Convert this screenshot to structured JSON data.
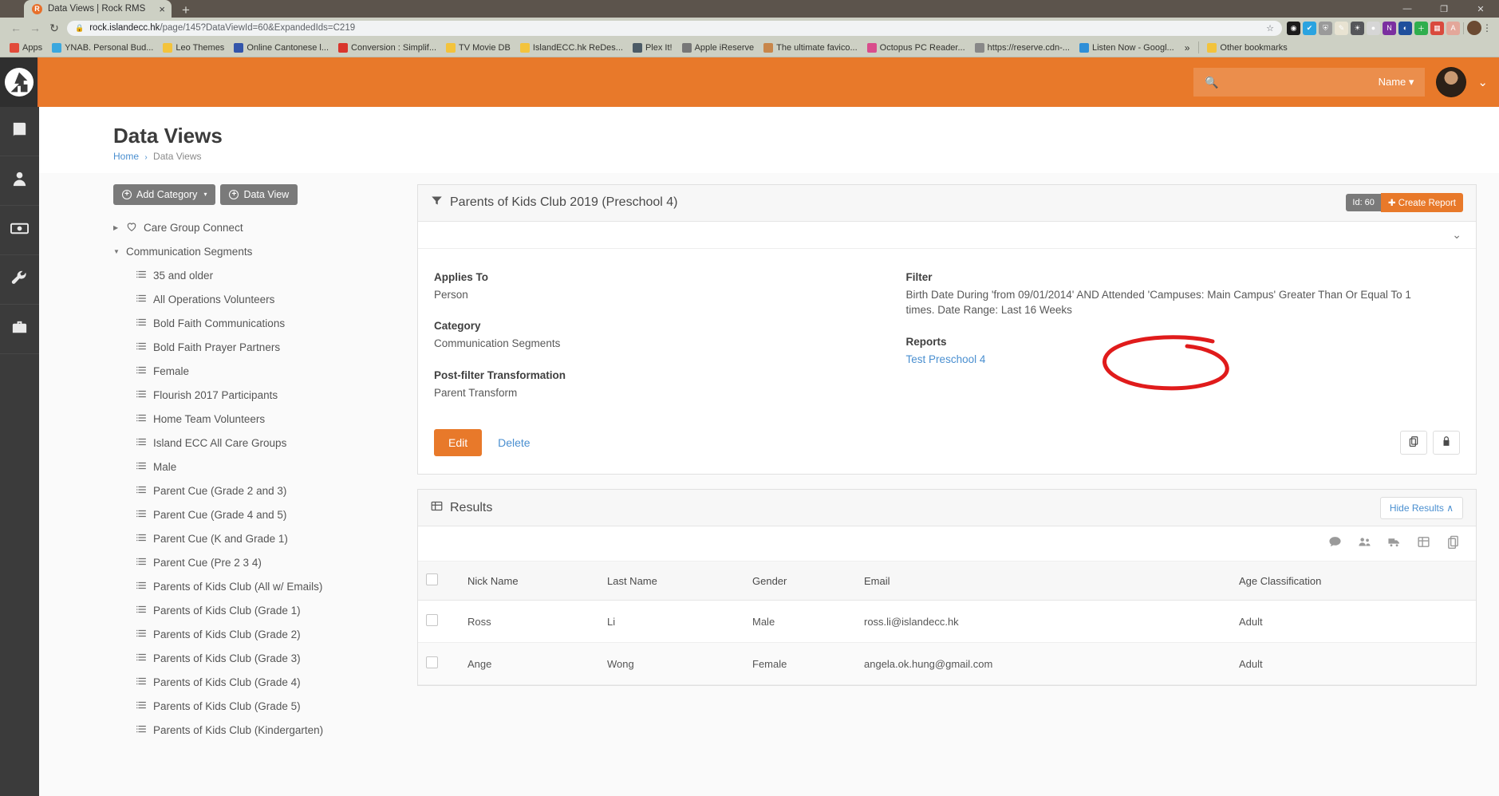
{
  "browser": {
    "tab": {
      "title": "Data Views | Rock RMS",
      "favicon_letter": "R",
      "close": "×"
    },
    "new_tab": "+",
    "window_controls": {
      "minimize": "—",
      "maximize": "❐",
      "close": "✕"
    },
    "nav": {
      "back": "←",
      "forward": "→",
      "reload": "↻"
    },
    "omnibox": {
      "lock": "🔒",
      "url_host": "rock.islandecc.hk",
      "url_path": "/page/145?DataViewId=60&ExpandedIds=C219",
      "star": "☆"
    },
    "extensions": [
      {
        "name": "chrome-extension-circle",
        "glyph": "◉",
        "color": "#1b1b1b"
      },
      {
        "name": "checkmark-extension",
        "glyph": "✔",
        "color": "#2aa3e0"
      },
      {
        "name": "shield-extension",
        "glyph": "⛨",
        "color": "#9a9a9a"
      },
      {
        "name": "paint-extension",
        "glyph": "✎",
        "color": "#e8e3d2"
      },
      {
        "name": "bulb-extension",
        "glyph": "☀",
        "color": "#55565a"
      },
      {
        "name": "balloon-extension",
        "glyph": "●",
        "color": "#d6d6d6"
      },
      {
        "name": "onenote-extension",
        "glyph": "N",
        "color": "#7b2fa0"
      },
      {
        "name": "lastpass-extension",
        "glyph": "◐",
        "color": "#1f4f9c"
      },
      {
        "name": "add-extension",
        "glyph": "＋",
        "color": "#2fae4e"
      },
      {
        "name": "colorpicker-extension",
        "glyph": "▦",
        "color": "#d94a3d"
      },
      {
        "name": "acrobat-extension",
        "glyph": "A",
        "color": "#e3a79a"
      }
    ],
    "menu_kebab": "⋮",
    "bookmarks": [
      {
        "label": "Apps",
        "icon": "apps-icon",
        "color": "#e24b3a"
      },
      {
        "label": "YNAB. Personal Bud...",
        "icon": "globe-icon",
        "color": "#3ba7de"
      },
      {
        "label": "Leo Themes",
        "icon": "folder-icon",
        "color": "#f3c33c"
      },
      {
        "label": "Online Cantonese l...",
        "icon": "site-icon",
        "color": "#3355aa"
      },
      {
        "label": "Conversion : Simplif...",
        "icon": "site-icon",
        "color": "#d9352c"
      },
      {
        "label": "TV Movie DB",
        "icon": "folder-icon",
        "color": "#f3c33c"
      },
      {
        "label": "IslandECC.hk ReDes...",
        "icon": "folder-icon",
        "color": "#f3c33c"
      },
      {
        "label": "Plex It!",
        "icon": "plex-icon",
        "color": "#4c5b66"
      },
      {
        "label": "Apple iReserve",
        "icon": "apple-icon",
        "color": "#777777"
      },
      {
        "label": "The ultimate favico...",
        "icon": "face-icon",
        "color": "#c8864a"
      },
      {
        "label": "Octopus PC Reader...",
        "icon": "octopus-icon",
        "color": "#d94d8c"
      },
      {
        "label": "https://reserve.cdn-...",
        "icon": "apple-icon",
        "color": "#888888"
      },
      {
        "label": "Listen Now - Googl...",
        "icon": "play-icon",
        "color": "#2f8fd8"
      }
    ],
    "bookmark_overflow": "»",
    "other_bookmarks": {
      "label": "Other bookmarks",
      "icon": "folder-icon"
    }
  },
  "rail": {
    "logo_name": "rock-rms-logo",
    "items": [
      {
        "name": "sidebar-item-cms",
        "icon": "book-icon"
      },
      {
        "name": "sidebar-item-people",
        "icon": "person-icon"
      },
      {
        "name": "sidebar-item-finance",
        "icon": "money-icon"
      },
      {
        "name": "sidebar-item-admin-tools",
        "icon": "wrench-icon"
      },
      {
        "name": "sidebar-item-toolbox",
        "icon": "toolbox-icon"
      }
    ]
  },
  "topbar": {
    "search_placeholder": "",
    "search_value": "",
    "search_scope": "Name",
    "scope_caret": "▾",
    "user_caret": "⌄"
  },
  "page": {
    "title": "Data Views",
    "breadcrumb": {
      "home": "Home",
      "separator": "›",
      "current": "Data Views"
    }
  },
  "tree": {
    "buttons": {
      "add_category": "Add Category",
      "add_category_caret": "▾",
      "data_view": "Data View"
    },
    "nodes": [
      {
        "label": "Care Group Connect",
        "level": 0,
        "icon": "heart-icon",
        "arrow": "▶",
        "expanded": false
      },
      {
        "label": "Communication Segments",
        "level": 0,
        "icon": "none",
        "arrow": "▼",
        "expanded": true
      },
      {
        "label": "35 and older",
        "level": 1,
        "icon": "list-icon"
      },
      {
        "label": "All Operations Volunteers",
        "level": 1,
        "icon": "list-icon"
      },
      {
        "label": "Bold Faith Communications",
        "level": 1,
        "icon": "list-icon"
      },
      {
        "label": "Bold Faith Prayer Partners",
        "level": 1,
        "icon": "list-icon"
      },
      {
        "label": "Female",
        "level": 1,
        "icon": "list-icon"
      },
      {
        "label": "Flourish 2017 Participants",
        "level": 1,
        "icon": "list-icon"
      },
      {
        "label": "Home Team Volunteers",
        "level": 1,
        "icon": "list-icon"
      },
      {
        "label": "Island ECC All Care Groups",
        "level": 1,
        "icon": "list-icon"
      },
      {
        "label": "Male",
        "level": 1,
        "icon": "list-icon"
      },
      {
        "label": "Parent Cue (Grade 2 and 3)",
        "level": 1,
        "icon": "list-icon"
      },
      {
        "label": "Parent Cue (Grade 4 and 5)",
        "level": 1,
        "icon": "list-icon"
      },
      {
        "label": "Parent Cue (K and Grade 1)",
        "level": 1,
        "icon": "list-icon"
      },
      {
        "label": "Parent Cue (Pre 2 3 4)",
        "level": 1,
        "icon": "list-icon"
      },
      {
        "label": "Parents of Kids Club (All w/ Emails)",
        "level": 1,
        "icon": "list-icon"
      },
      {
        "label": "Parents of Kids Club (Grade 1)",
        "level": 1,
        "icon": "list-icon"
      },
      {
        "label": "Parents of Kids Club (Grade 2)",
        "level": 1,
        "icon": "list-icon"
      },
      {
        "label": "Parents of Kids Club (Grade 3)",
        "level": 1,
        "icon": "list-icon"
      },
      {
        "label": "Parents of Kids Club (Grade 4)",
        "level": 1,
        "icon": "list-icon"
      },
      {
        "label": "Parents of Kids Club (Grade 5)",
        "level": 1,
        "icon": "list-icon"
      },
      {
        "label": "Parents of Kids Club (Kindergarten)",
        "level": 1,
        "icon": "list-icon"
      }
    ]
  },
  "detail_panel": {
    "title": "Parents of Kids Club 2019 (Preschool 4)",
    "id_badge": "Id: 60",
    "create_report": "Create Report",
    "collapse_caret": "⌄",
    "fields": {
      "applies_to_label": "Applies To",
      "applies_to_value": "Person",
      "category_label": "Category",
      "category_value": "Communication Segments",
      "post_filter_label": "Post-filter Transformation",
      "post_filter_value": "Parent Transform",
      "filter_label": "Filter",
      "filter_value": "Birth Date During 'from 09/01/2014' AND Attended 'Campuses: Main Campus' Greater Than Or Equal To 1 times. Date Range: Last 16 Weeks",
      "reports_label": "Reports",
      "reports_value": "Test Preschool 4"
    },
    "edit": "Edit",
    "delete": "Delete",
    "footer_icons": [
      {
        "name": "copy-icon"
      },
      {
        "name": "lock-icon"
      }
    ]
  },
  "results_panel": {
    "title": "Results",
    "hide_results": "Hide Results",
    "hide_caret": "∧",
    "grid_icons": [
      {
        "name": "communicate-icon"
      },
      {
        "name": "group-icon"
      },
      {
        "name": "merge-truck-icon"
      },
      {
        "name": "excel-export-icon"
      },
      {
        "name": "copy-icon"
      }
    ],
    "columns": [
      "Nick Name",
      "Last Name",
      "Gender",
      "Email",
      "Age Classification"
    ],
    "rows": [
      {
        "nick": "Ross",
        "last": "Li",
        "gender": "Male",
        "email": "ross.li@islandecc.hk",
        "age": "Adult"
      },
      {
        "nick": "Ange",
        "last": "Wong",
        "gender": "Female",
        "email": "angela.ok.hung@gmail.com",
        "age": "Adult"
      }
    ]
  },
  "annotation": {
    "name": "red-circle-annotation",
    "color": "#e01b1b"
  },
  "colors": {
    "brand_orange": "#e8792a",
    "link_blue": "#4a8fd0",
    "rail_dark": "#3b3b3b"
  }
}
